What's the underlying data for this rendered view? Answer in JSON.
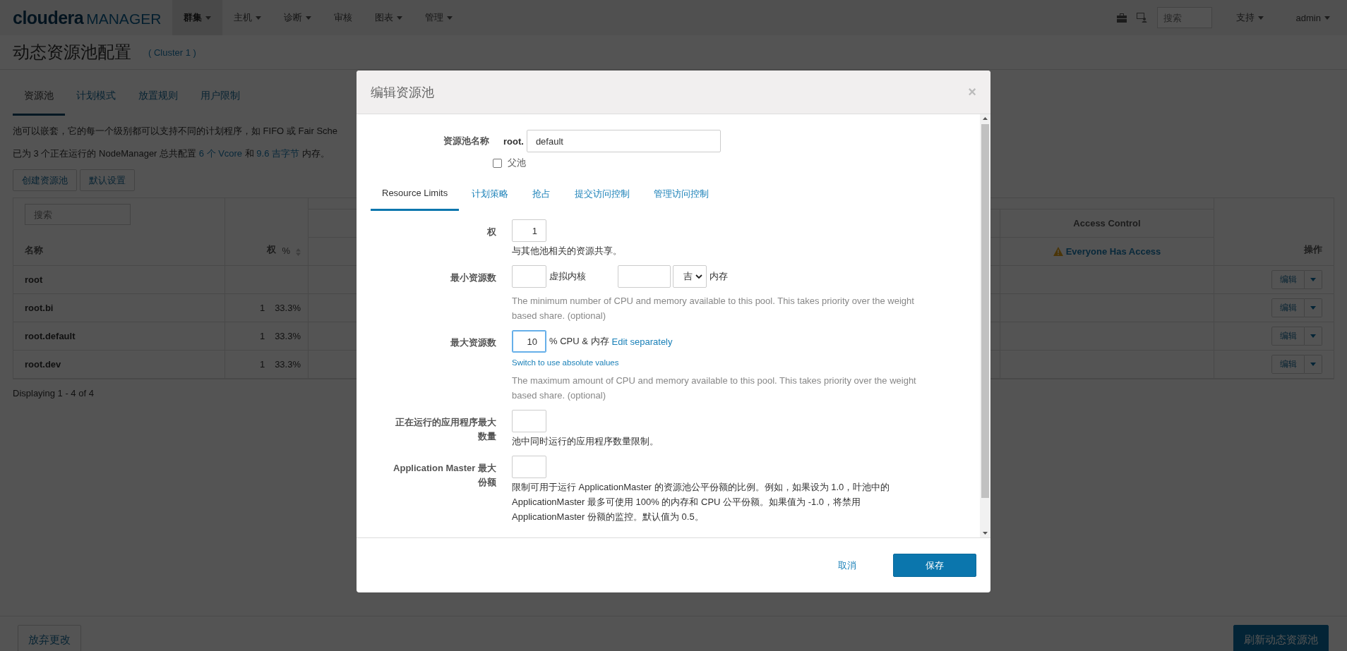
{
  "navbar": {
    "logo_brand": "cloudera",
    "logo_product": "MANAGER",
    "menu": [
      {
        "label": "群集",
        "dropdown": true,
        "selected": true
      },
      {
        "label": "主机",
        "dropdown": true,
        "selected": false
      },
      {
        "label": "诊断",
        "dropdown": true,
        "selected": false
      },
      {
        "label": "审核",
        "dropdown": false,
        "selected": false
      },
      {
        "label": "图表",
        "dropdown": true,
        "selected": false
      },
      {
        "label": "管理",
        "dropdown": true,
        "selected": false
      }
    ],
    "search": {
      "placeholder": "搜索"
    },
    "right_menu": [
      {
        "label": "支持"
      },
      {
        "label": "admin"
      }
    ]
  },
  "page": {
    "title": "动态资源池配置",
    "cluster": "( Cluster 1 )"
  },
  "tabs": [
    {
      "label": "资源池",
      "selected": true
    },
    {
      "label": "计划模式",
      "selected": false
    },
    {
      "label": "放置规则",
      "selected": false
    },
    {
      "label": "用户限制",
      "selected": false
    }
  ],
  "description": "池可以嵌套，它的每一个级别都可以支持不同的计划程序，如 FIFO 或 Fair Sche",
  "summary": {
    "before": "已为 3 个正在运行的 NodeManager 总共配置",
    "vcores": "6 个 Vcore",
    "middle": "和",
    "memory": "9.6 吉字节",
    "after": "内存。"
  },
  "buttons": [
    "创建资源池",
    "默认设置"
  ],
  "table": {
    "search": {
      "placeholder": "搜索"
    },
    "group_header": "Access Control",
    "columns": {
      "name": "名称",
      "weight": "权",
      "percent": "%",
      "access": "Everyone Has Access",
      "actions": "操作"
    },
    "rows": [
      {
        "name": "root",
        "action": "编辑"
      },
      {
        "name": "root.bi",
        "weight": "1",
        "percent": "33.3%",
        "action": "编辑"
      },
      {
        "name": "root.default",
        "weight": "1",
        "percent": "33.3%",
        "action": "编辑"
      },
      {
        "name": "root.dev",
        "weight": "1",
        "percent": "33.3%",
        "action": "编辑"
      }
    ]
  },
  "table_footer": "Displaying 1 - 4 of 4",
  "bottom_bar": {
    "discard": "放弃更改",
    "refresh": "刷新动态资源池"
  },
  "modal": {
    "title": "编辑资源池",
    "close": "×",
    "name_label": "资源池名称",
    "name_prefix": "root.",
    "name_value": "default",
    "parent_pool": {
      "label": "父池",
      "checked": false
    },
    "tabs": [
      {
        "label": "Resource Limits",
        "selected": true
      },
      {
        "label": "计划策略",
        "selected": false
      },
      {
        "label": "抢占",
        "selected": false
      },
      {
        "label": "提交访问控制",
        "selected": false
      },
      {
        "label": "管理访问控制",
        "selected": false
      }
    ],
    "fields": [
      {
        "kind": "single",
        "label": "权",
        "value": "1",
        "focused": false,
        "help": "与其他池相关的资源共享。",
        "help_muted": false
      },
      {
        "kind": "min",
        "label": "最小资源数",
        "focused": false,
        "cores_unit": "虚拟内核",
        "memory_select": "吉",
        "memory_unit": "内存",
        "help": "The minimum number of CPU and memory available to this pool. This takes priority over the weight based share. (optional)",
        "help_muted": true
      },
      {
        "kind": "max",
        "label": "最大资源数",
        "value": "10",
        "focused": true,
        "unit": "% CPU & 内存",
        "link": "Edit separately",
        "switch_link": "Switch to use absolute values",
        "help": "The maximum amount of CPU and memory available to this pool. This takes priority over the weight based share. (optional)",
        "help_muted": true
      },
      {
        "kind": "single",
        "label": "正在运行的应用程序最大数量",
        "focused": false,
        "help": "池中同时运行的应用程序数量限制。",
        "help_muted": false
      },
      {
        "kind": "single",
        "label": "Application Master 最大份额",
        "focused": false,
        "help": "限制可用于运行 ApplicationMaster 的资源池公平份额的比例。例如，如果设为 1.0，叶池中的 ApplicationMaster 最多可使用 100% 的内存和 CPU 公平份额。如果值为 -1.0，将禁用 ApplicationMaster 份额的监控。默认值为 0.5。",
        "help_muted": false
      }
    ],
    "cancel": "取消",
    "save": "保存"
  }
}
